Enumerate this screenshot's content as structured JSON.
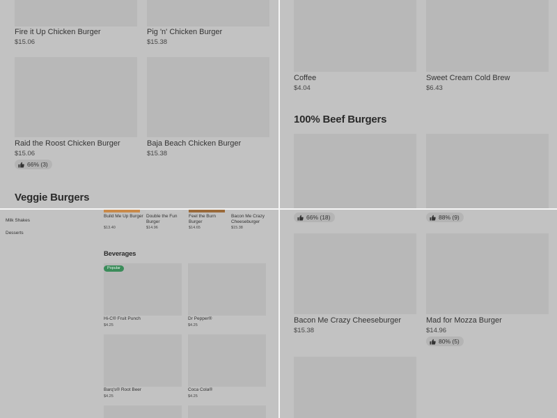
{
  "top_left": {
    "items": [
      {
        "name": "Fire it Up Chicken Burger",
        "price": "$15.06"
      },
      {
        "name": "Pig 'n' Chicken Burger",
        "price": "$15.38"
      },
      {
        "name": "Raid the Roost Chicken Burger",
        "price": "$15.06",
        "rating": "66% (3)"
      },
      {
        "name": "Baja Beach Chicken Burger",
        "price": "$15.38"
      }
    ],
    "section_title": "Veggie Burgers"
  },
  "top_right": {
    "items": [
      {
        "name": "Coffee",
        "price": "$4.04"
      },
      {
        "name": "Sweet Cream Cold Brew",
        "price": "$6.43"
      }
    ],
    "section_title": "100% Beef Burgers"
  },
  "bottom_left": {
    "sidebar": [
      "Milk Shakes",
      "Desserts"
    ],
    "burgers": [
      {
        "name": "Build Me Up Burger",
        "price": "$13.40",
        "color": "#c98a4a"
      },
      {
        "name": "Double the Fun Burger",
        "price": "$14.96",
        "color": "#c4c4c4"
      },
      {
        "name": "Feel the Burn Burger",
        "price": "$14.65",
        "color": "#9a6a3a"
      },
      {
        "name": "Bacon Me Crazy Cheeseburger",
        "price": "$15.38",
        "color": "#c2c2c2"
      }
    ],
    "section_title": "Beverages",
    "badge": "Popular",
    "beverages": [
      {
        "name": "Hi-C® Fruit Punch",
        "price": "$4.25"
      },
      {
        "name": "Dr Pepper®",
        "price": "$4.25"
      },
      {
        "name": "Barq's® Root Beer",
        "price": "$4.25"
      },
      {
        "name": "Coca Cola®",
        "price": "$4.25"
      }
    ]
  },
  "bottom_right": {
    "ratings": [
      "66% (18)",
      "88% (9)"
    ],
    "items": [
      {
        "name": "Bacon Me Crazy Cheeseburger",
        "price": "$15.38"
      },
      {
        "name": "Mad for Mozza Burger",
        "price": "$14.96",
        "rating": "80% (5)"
      }
    ]
  },
  "icons": {
    "rating": "thumbs-up-icon"
  }
}
